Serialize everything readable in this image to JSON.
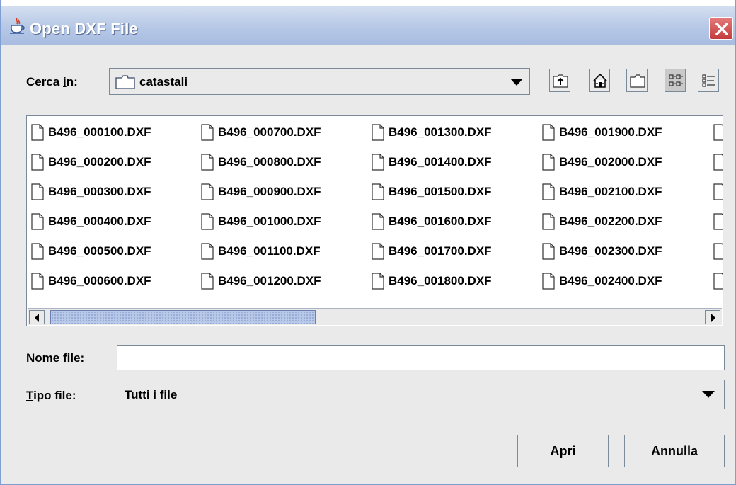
{
  "window": {
    "title": "Open DXF File"
  },
  "look_in": {
    "label_pre": "Cerca ",
    "label_mnemonic": "i",
    "label_post": "n:",
    "folder": "catastali"
  },
  "toolbar": {
    "up": "up-folder-icon",
    "home": "home-icon",
    "new_folder": "new-folder-icon",
    "list_view": "list-view-icon",
    "details_view": "details-view-icon"
  },
  "files": {
    "col1": [
      "B496_000100.DXF",
      "B496_000200.DXF",
      "B496_000300.DXF",
      "B496_000400.DXF",
      "B496_000500.DXF",
      "B496_000600.DXF"
    ],
    "col2": [
      "B496_000700.DXF",
      "B496_000800.DXF",
      "B496_000900.DXF",
      "B496_001000.DXF",
      "B496_001100.DXF",
      "B496_001200.DXF"
    ],
    "col3": [
      "B496_001300.DXF",
      "B496_001400.DXF",
      "B496_001500.DXF",
      "B496_001600.DXF",
      "B496_001700.DXF",
      "B496_001800.DXF"
    ],
    "col4": [
      "B496_001900.DXF",
      "B496_002000.DXF",
      "B496_002100.DXF",
      "B496_002200.DXF",
      "B496_002300.DXF",
      "B496_002400.DXF"
    ]
  },
  "file_name": {
    "label_mnemonic": "N",
    "label_post": "ome file:",
    "value": ""
  },
  "file_type": {
    "label_mnemonic": "T",
    "label_post": "ipo file:",
    "value": "Tutti i file"
  },
  "buttons": {
    "open": "Apri",
    "cancel": "Annulla"
  },
  "colors": {
    "title_bar": "#b6c8e6",
    "panel": "#ebeaea",
    "close": "#c43c3c",
    "scroll_thumb": "#b8c8e8"
  }
}
